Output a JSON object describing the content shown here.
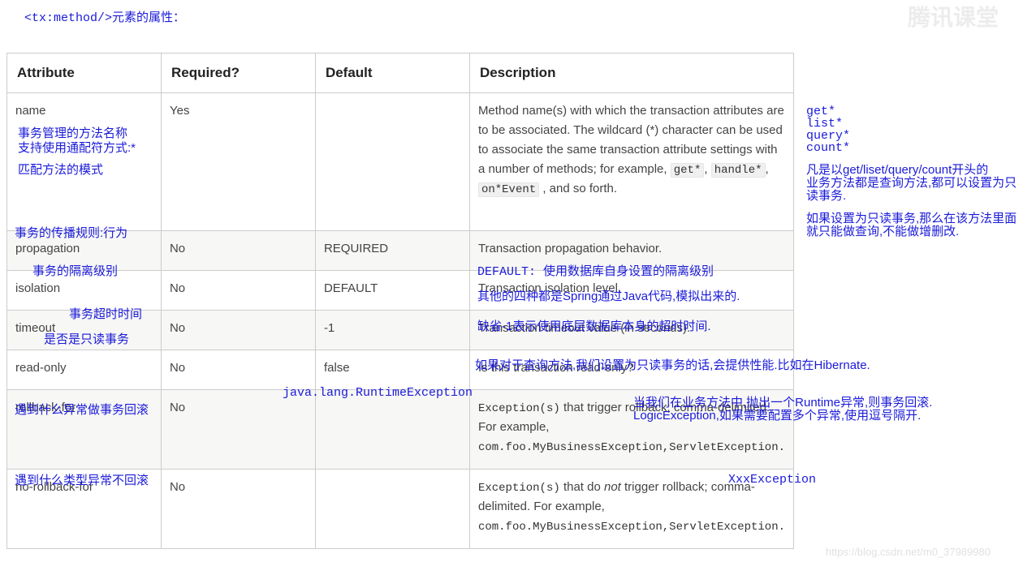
{
  "title": "<tx:method/>元素的属性：",
  "headers": [
    "Attribute",
    "Required?",
    "Default",
    "Description"
  ],
  "rows": [
    {
      "attr": "name",
      "req": "Yes",
      "def": "",
      "descPrefix": "Method name(s) with which the transaction attributes are to be associated. The wildcard (*) character can be used to associate the same transaction attribute settings with a number of methods; for example, ",
      "codes": [
        "get*",
        "handle*",
        "on*Event"
      ],
      "descSuffix": ", and so forth."
    },
    {
      "attr": "propagation",
      "req": "No",
      "def": "REQUIRED",
      "desc": "Transaction propagation behavior."
    },
    {
      "attr": "isolation",
      "req": "No",
      "def": "DEFAULT",
      "desc": "Transaction isolation level."
    },
    {
      "attr": "timeout",
      "req": "No",
      "def": "-1",
      "desc": "Transaction timeout value (in seconds)."
    },
    {
      "attr": "read-only",
      "req": "No",
      "def": "false",
      "desc": "Is this transaction read-only?"
    },
    {
      "attr": "rollback-for",
      "req": "No",
      "def": "",
      "descA": "Exception(s)",
      "descB": " that trigger rollback; comma-delimited. For example, ",
      "code": "com.foo.MyBusinessException,ServletException."
    },
    {
      "attr": "no-rollback-for",
      "req": "No",
      "def": "",
      "descA": "Exception(s)",
      "descB": " that do ",
      "not": "not",
      "descC": " trigger rollback; comma-delimited. For example, ",
      "code": "com.foo.MyBusinessException,ServletException."
    }
  ],
  "ann": {
    "name1": "事务管理的方法名称",
    "name2": "支持使用通配符方式:*",
    "name3": "匹配方法的模式",
    "propagation_label": "事务的传播规则:行为",
    "isolation_label": "事务的隔离级别",
    "timeout_label": "事务超时时间",
    "readonly_label": "是否是只读事务",
    "rollback_label": "遇到什么异常做事务回滚",
    "norollback_label": "遇到什么类型异常不回滚",
    "rollback_default": "java.lang.RuntimeException",
    "isolation_note1": "DEFAULT: 使用数据库自身设置的隔离级别",
    "isolation_note2": "其他的四种都是Spring通过Java代码,模拟出来的.",
    "timeout_note": "缺省-1表示使用底层数据库本身的超时时间.",
    "readonly_note": "如果对于查询方法,我们设置为只读事务的话,会提供性能.比如在Hibernate.",
    "rollback_note1": "当我们在业务方法中,抛出一个Runtime异常,则事务回滚.",
    "rollback_note2": "LogicException,如果需要配置多个异常,使用逗号隔开.",
    "norollback_note": "XxxException",
    "side_list1": "get*",
    "side_list2": "list*",
    "side_list3": "query*",
    "side_list4": "count*",
    "side_p1a": "凡是以get/liset/query/count开头的",
    "side_p1b": "业务方法都是查询方法,都可以设置为只",
    "side_p1c": "读事务.",
    "side_p2a": "如果设置为只读事务,那么在该方法里面",
    "side_p2b": "就只能做查询,不能做增删改."
  },
  "watermark": {
    "logo": "腾讯课堂",
    "url": "https://blog.csdn.net/m0_37989980"
  }
}
